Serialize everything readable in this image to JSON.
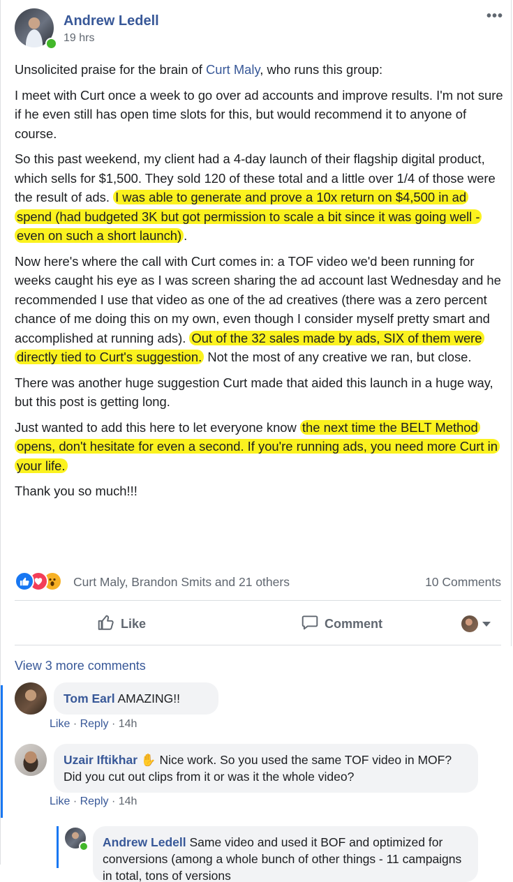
{
  "post": {
    "author": "Andrew Ledell",
    "time": "19 hrs",
    "more_icon": "•••",
    "paragraphs": [
      [
        {
          "t": "Unsolicited praise for the brain of "
        },
        {
          "t": "Curt Maly",
          "link": true
        },
        {
          "t": ", who runs this group:"
        }
      ],
      [
        {
          "t": "I meet with Curt once a week to go over ad accounts and improve results. I'm not sure if he even still has open time slots for this, but would recommend it to anyone of course."
        }
      ],
      [
        {
          "t": "So this past weekend, my client had a 4-day launch of their flagship digital product, which sells for $1,500. They sold 120 of these total and a little over 1/4 of those were the result of ads. "
        },
        {
          "t": "I was able to generate and prove a 10x return on $4,500 in ad spend (had budgeted 3K but got permission to scale a bit since it was going well - even on such a short launch)",
          "hl": true
        },
        {
          "t": "."
        }
      ],
      [
        {
          "t": "Now here's where the call with Curt comes in: a TOF video we'd been running for weeks caught his eye as I was screen sharing the ad account last Wednesday and he recommended I use that video as one of the ad creatives (there was a zero percent chance of me doing this on my own, even though I consider myself pretty smart and accomplished at running ads). "
        },
        {
          "t": "Out of the 32 sales made by ads, SIX of them were directly tied to Curt's suggestion.",
          "hl": true
        },
        {
          "t": " Not the most of any creative we ran, but close."
        }
      ],
      [
        {
          "t": "There was another huge suggestion Curt made that aided this launch in a huge way, but this post is getting long."
        }
      ],
      [
        {
          "t": "Just wanted to add this here to let everyone know "
        },
        {
          "t": "the next time the BELT Method opens, don't hesitate for even a second. If you're running ads, you need more Curt in your life.",
          "hl": true
        }
      ],
      [
        {
          "t": "Thank you so much!!!"
        }
      ]
    ]
  },
  "reactions": {
    "icons": [
      "like-icon",
      "love-icon",
      "wow-icon"
    ],
    "reactors": "Curt Maly, Brandon Smits and 21 others",
    "comments_count": "10 Comments"
  },
  "actions": {
    "like": "Like",
    "comment": "Comment"
  },
  "comments": {
    "view_more": "View 3 more comments",
    "items": [
      {
        "name": "Tom Earl",
        "text": " AMAZING!!",
        "like": "Like",
        "reply": "Reply",
        "time": "14h"
      },
      {
        "name": "Uzair Iftikhar",
        "text": " Nice work. So you used the same TOF video in MOF? Did you cut out clips from it or was it the whole video?",
        "like": "Like",
        "reply": "Reply",
        "time": "14h"
      },
      {
        "name": "Andrew Ledell",
        "text": " Same video and used it BOF and optimized for conversions (among a whole bunch of other things - 11 campaigns in total, tons of versions"
      }
    ]
  }
}
